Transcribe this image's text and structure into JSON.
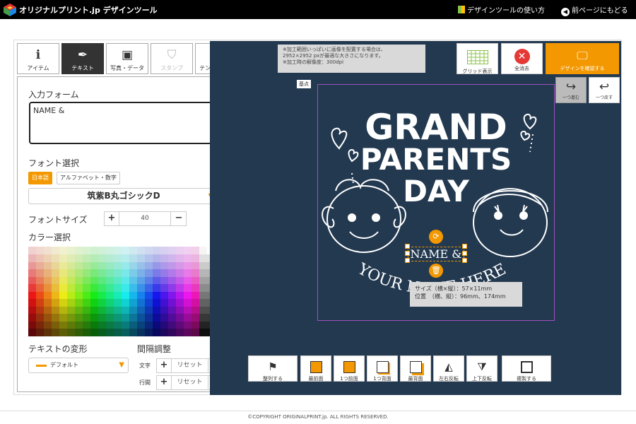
{
  "header": {
    "brand": "オリジナルプリント.jp デザインツール",
    "howto_label": "デザインツールの使い方",
    "back_label": "前ページにもどる"
  },
  "tabs": [
    {
      "label": "アイテム",
      "icon": "item-info-icon"
    },
    {
      "label": "テキスト",
      "icon": "pen-icon",
      "active": true
    },
    {
      "label": "写真・データ",
      "icon": "image-icon"
    },
    {
      "label": "スタンプ",
      "icon": "stamp-icon",
      "disabled": true
    },
    {
      "label": "テンプレート",
      "icon": "compass-icon"
    }
  ],
  "panel": {
    "input_label": "入力フォーム",
    "input_value": "NAME &",
    "font_label": "フォント選択",
    "lang_jp": "日本語",
    "lang_alpha": "アルファベット・数字",
    "font_name": "筑紫B丸ゴシックD",
    "font_size_label": "フォントサイズ",
    "font_size_value": "40",
    "color_label": "カラー選択",
    "deform_label": "テキストの変形",
    "deform_value": "デフォルト",
    "spacing_label": "間隔調整",
    "char_label": "文字",
    "line_label": "行間",
    "reset_label": "リセット"
  },
  "canvas": {
    "notice_lines": [
      "※加工範囲いっぱいに画像を配置する場合は、",
      "2952×2952 pxが最適な大きさになります。",
      "※加工時の解像度：300dpi"
    ],
    "grid_label": "グリッド表示",
    "clear_label": "全消去",
    "confirm_label": "デザインを確認する",
    "redo_label": "一つ進む",
    "undo_label": "一つ戻す",
    "base_label": "基点",
    "design_lines": [
      "GRAND",
      "PARENTS",
      "DAY"
    ],
    "arc_text": "YOUR NAME HERE",
    "selected_text": "NAME &",
    "info_size": "サイズ（横×縦）：57×11mm",
    "info_pos": "位置　（横、縦）：96mm、174mm"
  },
  "bottom_toolbar": [
    {
      "label": "整列する",
      "icon": "align-icon"
    },
    {
      "label": "最前面",
      "icon": "bring-front-icon"
    },
    {
      "label": "1つ前面",
      "icon": "forward-icon"
    },
    {
      "label": "1つ背面",
      "icon": "backward-icon"
    },
    {
      "label": "最背面",
      "icon": "send-back-icon"
    },
    {
      "label": "左右反転",
      "icon": "flip-h-icon"
    },
    {
      "label": "上下反転",
      "icon": "flip-v-icon"
    },
    {
      "label": "複製する",
      "icon": "duplicate-icon"
    }
  ],
  "footer": {
    "copyright": "©COPYRIGHT ORIGINALPRINT.jp. ALL RIGHTS RESERVED."
  },
  "colors": {
    "accent": "#f39800",
    "canvas_bg": "#233950",
    "header_bg": "#000000"
  }
}
